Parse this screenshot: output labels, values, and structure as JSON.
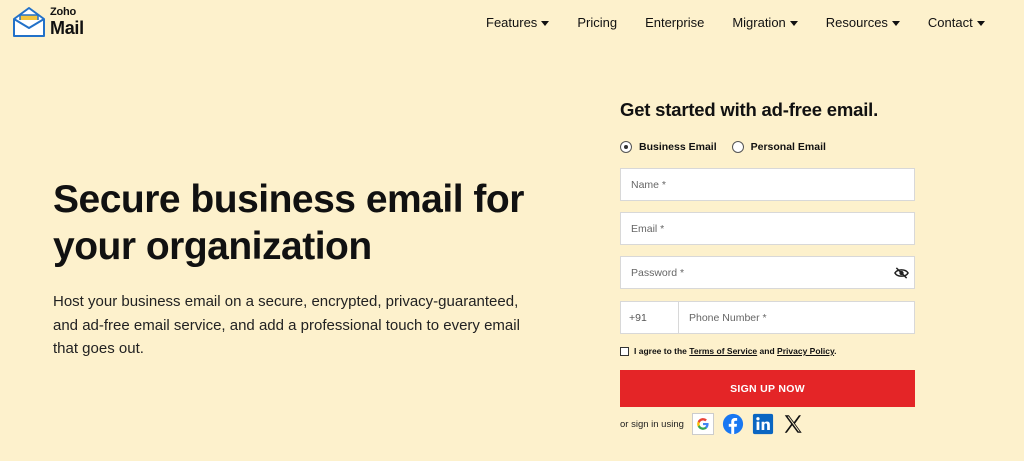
{
  "logo": {
    "brand": "Zoho",
    "product": "Mail"
  },
  "nav": {
    "items": [
      {
        "label": "Features",
        "has_dropdown": true
      },
      {
        "label": "Pricing",
        "has_dropdown": false
      },
      {
        "label": "Enterprise",
        "has_dropdown": false
      },
      {
        "label": "Migration",
        "has_dropdown": true
      },
      {
        "label": "Resources",
        "has_dropdown": true
      },
      {
        "label": "Contact",
        "has_dropdown": true
      }
    ]
  },
  "hero": {
    "title": "Secure business email for your organization",
    "description": "Host your business email on a secure, encrypted, privacy-guaranteed, and ad-free email service, and add a professional touch to every email that goes out."
  },
  "form": {
    "title": "Get started with ad-free email.",
    "radio_business": "Business Email",
    "radio_personal": "Personal Email",
    "selected": "Business Email",
    "name_placeholder": "Name *",
    "email_placeholder": "Email *",
    "password_placeholder": "Password *",
    "country_code": "+91",
    "phone_placeholder": "Phone Number *",
    "agree_prefix": "I agree to the",
    "terms_link": "Terms of Service",
    "agree_and": "and",
    "privacy_link": "Privacy Policy",
    "agree_suffix": ".",
    "signup_label": "SIGN UP NOW",
    "social_label": "or sign in using"
  },
  "colors": {
    "background": "#fdf1cc",
    "accent": "#e42527",
    "logo_blue": "#2271c9",
    "logo_yellow": "#f5c53d",
    "facebook": "#1877f2",
    "linkedin": "#0a66c2"
  }
}
